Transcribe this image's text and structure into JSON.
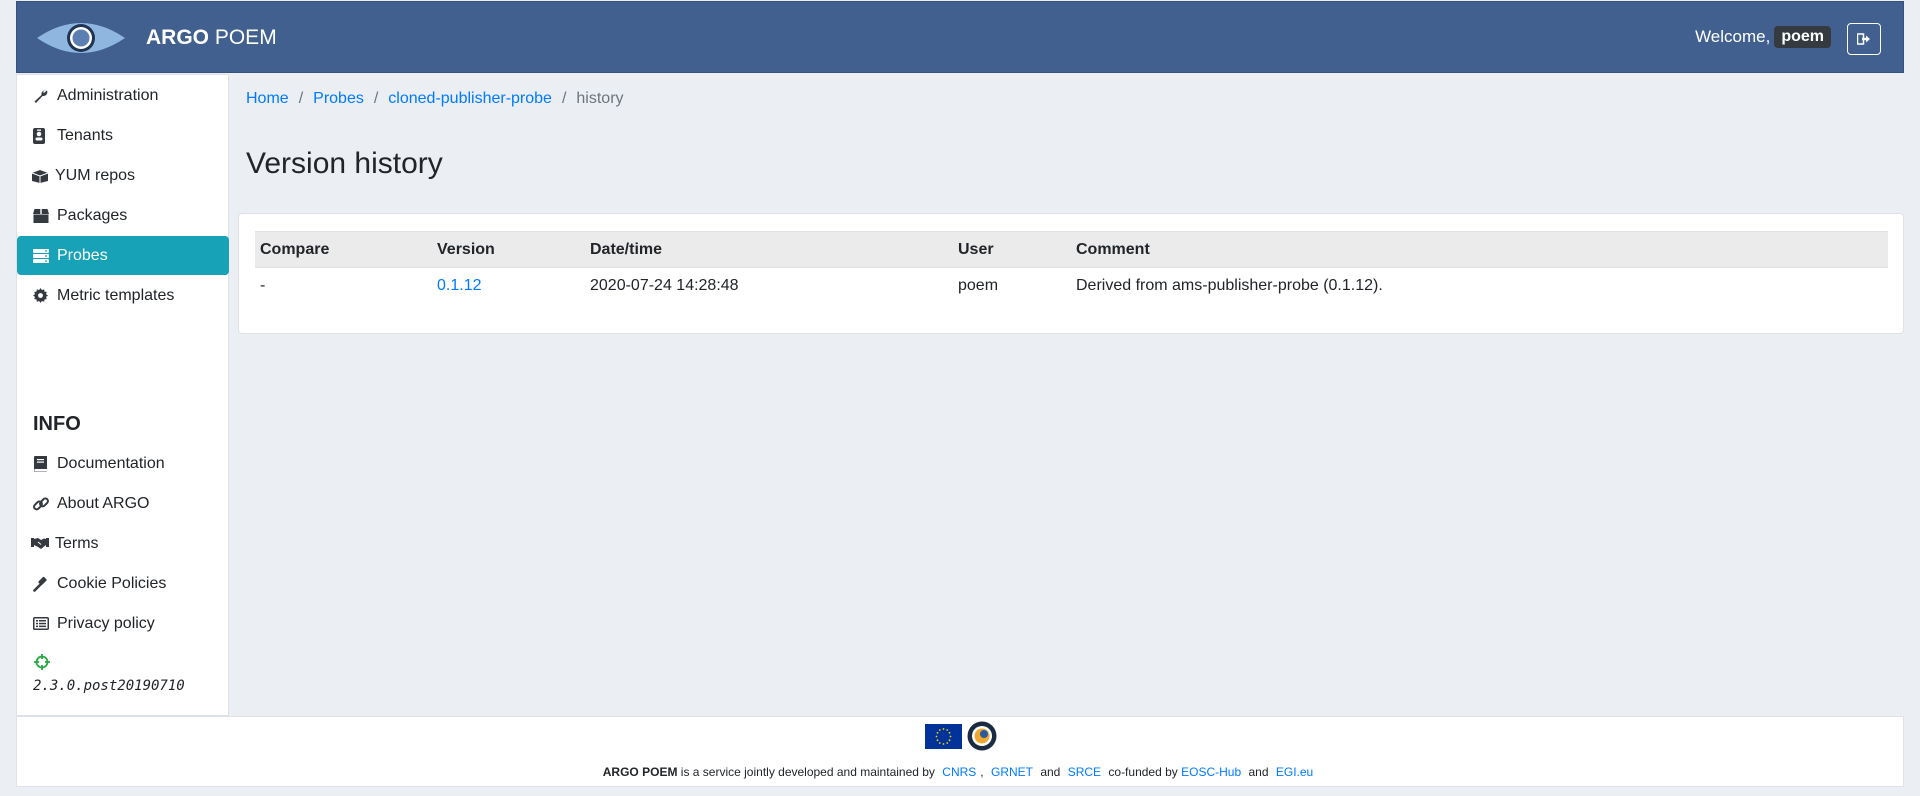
{
  "header": {
    "brand_bold": "ARGO",
    "brand_rest": "POEM",
    "welcome_text": "Welcome,",
    "username": "poem",
    "brand_color": "#41608f"
  },
  "sidebar": {
    "items": [
      {
        "label": "Administration",
        "icon": "wrench-icon"
      },
      {
        "label": "Tenants",
        "icon": "id-badge-icon"
      },
      {
        "label": "YUM repos",
        "icon": "boxes-icon"
      },
      {
        "label": "Packages",
        "icon": "box-icon"
      },
      {
        "label": "Probes",
        "icon": "server-icon",
        "active": true
      },
      {
        "label": "Metric templates",
        "icon": "gear-icon"
      }
    ],
    "info_title": "INFO",
    "info_items": [
      {
        "label": "Documentation",
        "icon": "book-icon"
      },
      {
        "label": "About ARGO",
        "icon": "link-icon"
      },
      {
        "label": "Terms",
        "icon": "handshake-icon"
      },
      {
        "label": "Cookie Policies",
        "icon": "gavel-icon"
      },
      {
        "label": "Privacy policy",
        "icon": "list-icon"
      }
    ],
    "version": "2.3.0.post20190710",
    "active_color": "#17a2b8"
  },
  "breadcrumb": {
    "home": "Home",
    "probes": "Probes",
    "probe": "cloned-publisher-probe",
    "current": "history"
  },
  "page_title": "Version history",
  "table": {
    "headers": [
      "Compare",
      "Version",
      "Date/time",
      "User",
      "Comment"
    ],
    "rows": [
      {
        "compare": "-",
        "version": "0.1.12",
        "datetime": "2020-07-24 14:28:48",
        "user": "poem",
        "comment": "Derived from ams-publisher-probe (0.1.12)."
      }
    ]
  },
  "footer": {
    "product": "ARGO POEM",
    "text1": "is a service jointly developed and maintained by",
    "cnrs": "CNRS",
    "comma": ",",
    "grnet": "GRNET",
    "and1": "and",
    "srce": "SRCE",
    "cofunded": "co-funded by",
    "eosc": "EOSC-Hub",
    "and2": "and",
    "egi": "EGI.eu"
  }
}
